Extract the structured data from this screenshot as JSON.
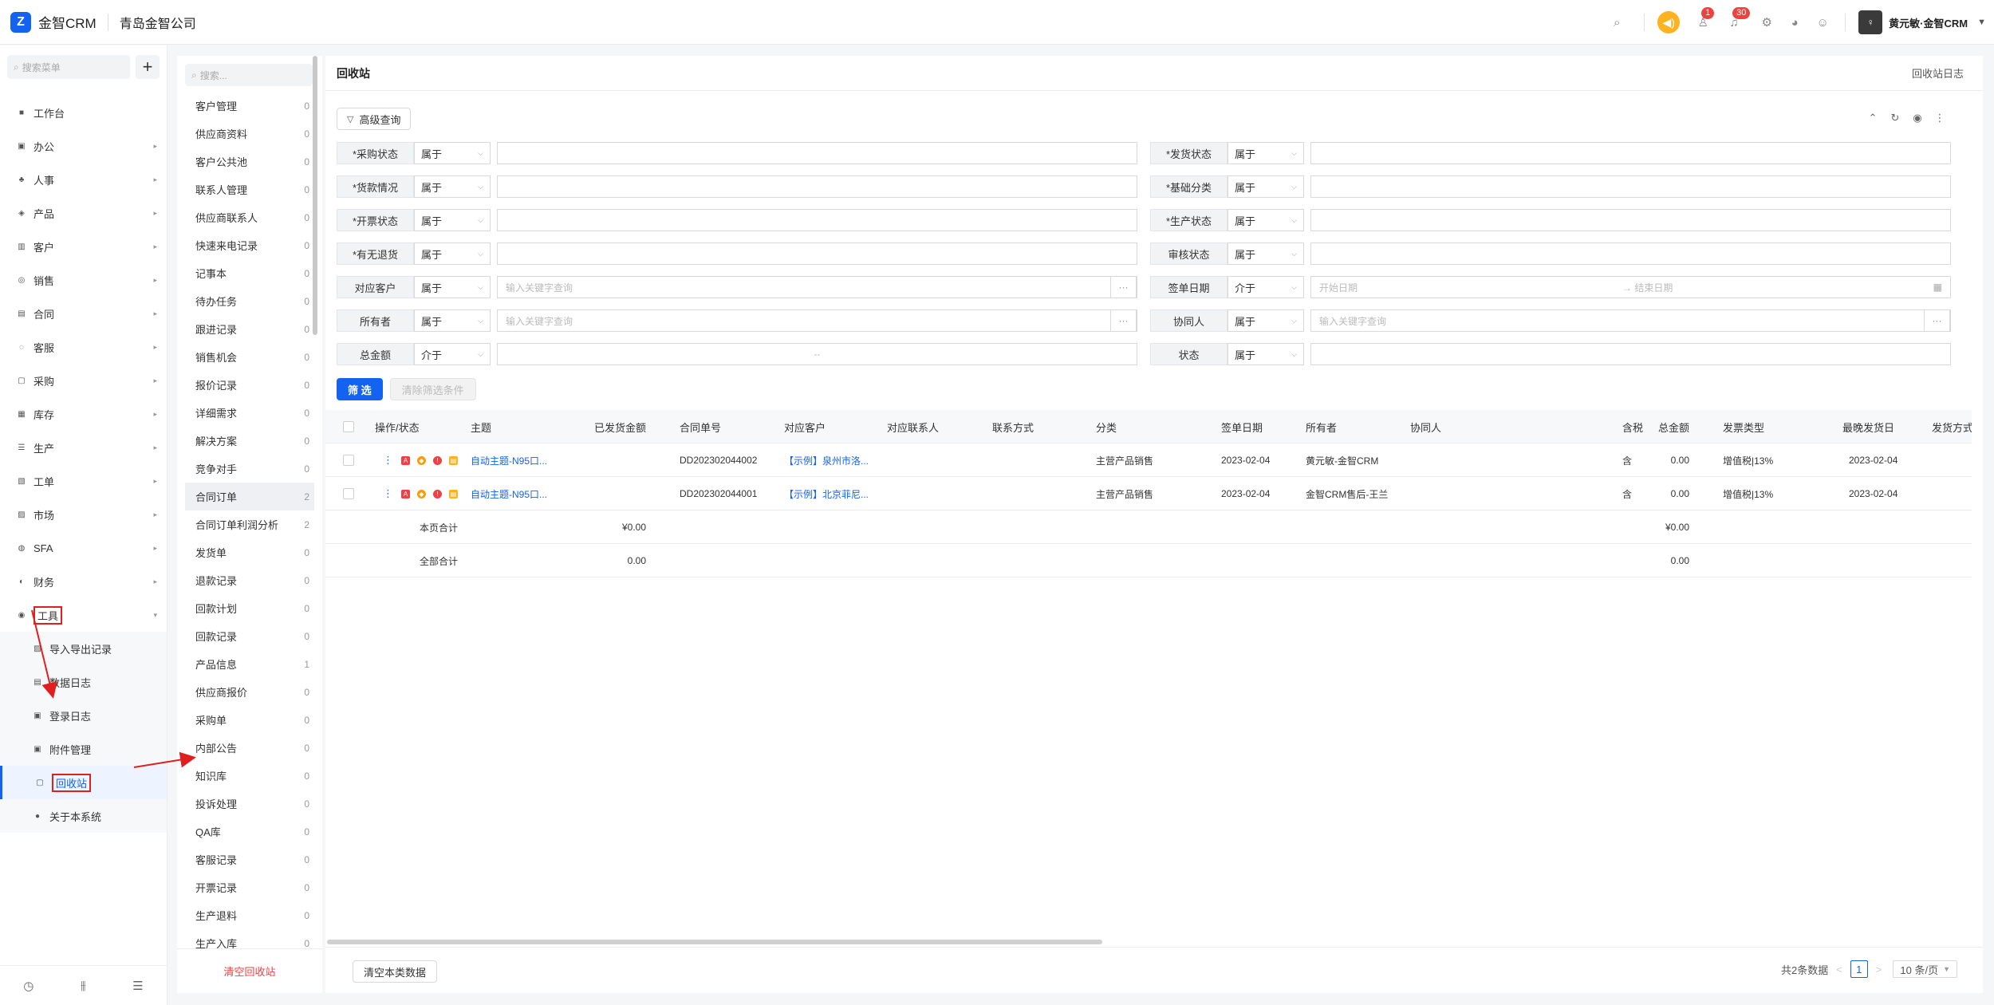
{
  "header": {
    "logo_char": "Z",
    "brand": "金智CRM",
    "company": "青岛金智公司",
    "badge_tasks": "1",
    "badge_notify": "30",
    "username": "黄元敏·金智CRM"
  },
  "nav": {
    "search_placeholder": "搜索菜单",
    "items": [
      {
        "label": "工作台",
        "icon": "■"
      },
      {
        "label": "办公",
        "icon": "▣"
      },
      {
        "label": "人事",
        "icon": "♣"
      },
      {
        "label": "产品",
        "icon": "◈"
      },
      {
        "label": "客户",
        "icon": "▥"
      },
      {
        "label": "销售",
        "icon": "◎"
      },
      {
        "label": "合同",
        "icon": "▤"
      },
      {
        "label": "客服",
        "icon": "◌"
      },
      {
        "label": "采购",
        "icon": "▢"
      },
      {
        "label": "库存",
        "icon": "▦"
      },
      {
        "label": "生产",
        "icon": "☰"
      },
      {
        "label": "工单",
        "icon": "▧"
      },
      {
        "label": "市场",
        "icon": "▨"
      },
      {
        "label": "SFA",
        "icon": "◍"
      },
      {
        "label": "财务",
        "icon": "◐"
      },
      {
        "label": "工具",
        "icon": "◉"
      }
    ],
    "sub_items": [
      {
        "label": "导入导出记录",
        "icon": "▨"
      },
      {
        "label": "数据日志",
        "icon": "▤"
      },
      {
        "label": "登录日志",
        "icon": "▣"
      },
      {
        "label": "附件管理",
        "icon": "▣"
      },
      {
        "label": "回收站",
        "icon": "▢"
      },
      {
        "label": "关于本系统",
        "icon": "●"
      }
    ]
  },
  "categories": {
    "search_placeholder": "搜索...",
    "items": [
      {
        "label": "客户管理",
        "count": "0"
      },
      {
        "label": "供应商资料",
        "count": "0"
      },
      {
        "label": "客户公共池",
        "count": "0"
      },
      {
        "label": "联系人管理",
        "count": "0"
      },
      {
        "label": "供应商联系人",
        "count": "0"
      },
      {
        "label": "快速来电记录",
        "count": "0"
      },
      {
        "label": "记事本",
        "count": "0"
      },
      {
        "label": "待办任务",
        "count": "0"
      },
      {
        "label": "跟进记录",
        "count": "0"
      },
      {
        "label": "销售机会",
        "count": "0"
      },
      {
        "label": "报价记录",
        "count": "0"
      },
      {
        "label": "详细需求",
        "count": "0"
      },
      {
        "label": "解决方案",
        "count": "0"
      },
      {
        "label": "竞争对手",
        "count": "0"
      },
      {
        "label": "合同订单",
        "count": "2"
      },
      {
        "label": "合同订单利润分析",
        "count": "2"
      },
      {
        "label": "发货单",
        "count": "0"
      },
      {
        "label": "退款记录",
        "count": "0"
      },
      {
        "label": "回款计划",
        "count": "0"
      },
      {
        "label": "回款记录",
        "count": "0"
      },
      {
        "label": "产品信息",
        "count": "1"
      },
      {
        "label": "供应商报价",
        "count": "0"
      },
      {
        "label": "采购单",
        "count": "0"
      },
      {
        "label": "内部公告",
        "count": "0"
      },
      {
        "label": "知识库",
        "count": "0"
      },
      {
        "label": "投诉处理",
        "count": "0"
      },
      {
        "label": "QA库",
        "count": "0"
      },
      {
        "label": "客服记录",
        "count": "0"
      },
      {
        "label": "开票记录",
        "count": "0"
      },
      {
        "label": "生产退料",
        "count": "0"
      },
      {
        "label": "生产入库",
        "count": "0"
      }
    ],
    "empty_button": "清空回收站"
  },
  "main": {
    "title": "回收站",
    "log_link": "回收站日志",
    "advanced_query": "高级查询",
    "filters_left": [
      {
        "label": "*采购状态",
        "op": "属于",
        "placeholder": ""
      },
      {
        "label": "*货款情况",
        "op": "属于",
        "placeholder": ""
      },
      {
        "label": "*开票状态",
        "op": "属于",
        "placeholder": ""
      },
      {
        "label": "*有无退货",
        "op": "属于",
        "placeholder": ""
      },
      {
        "label": "对应客户",
        "op": "属于",
        "placeholder": "输入关键字查询"
      },
      {
        "label": "所有者",
        "op": "属于",
        "placeholder": "输入关键字查询"
      },
      {
        "label": "总金额",
        "op": "介于",
        "placeholder": "--"
      }
    ],
    "filters_right": [
      {
        "label": "*发货状态",
        "op": "属于",
        "placeholder": ""
      },
      {
        "label": "*基础分类",
        "op": "属于",
        "placeholder": ""
      },
      {
        "label": "*生产状态",
        "op": "属于",
        "placeholder": ""
      },
      {
        "label": "审核状态",
        "op": "属于",
        "placeholder": ""
      },
      {
        "label": "签单日期",
        "op": "介于",
        "placeholder": "开始日期",
        "placeholder2": "→  结束日期"
      },
      {
        "label": "协同人",
        "op": "属于",
        "placeholder": "输入关键字查询"
      },
      {
        "label": "状态",
        "op": "属于",
        "placeholder": ""
      }
    ],
    "filter_button": "筛 选",
    "clear_filter_button": "清除筛选条件",
    "columns": [
      "操作/状态",
      "主题",
      "已发货金额",
      "合同单号",
      "对应客户",
      "对应联系人",
      "联系方式",
      "分类",
      "签单日期",
      "所有者",
      "协同人",
      "总金额",
      "含税",
      "发票类型",
      "最晚发货日",
      "发货方式"
    ],
    "rows": [
      {
        "subject": "自动主题-N95口...",
        "shipped": "",
        "number": "DD202302044002",
        "customer": "【示例】泉州市洛...",
        "contact": "",
        "phone": "",
        "category": "主营产品销售",
        "date": "2023-02-04",
        "owner": "黄元敏-金智CRM",
        "collab": "",
        "total": "0.00",
        "tax": "含",
        "invoice": "增值税|13%",
        "latest": "2023-02-04",
        "method": ""
      },
      {
        "subject": "自动主题-N95口...",
        "shipped": "",
        "number": "DD202302044001",
        "customer": "【示例】北京菲尼...",
        "contact": "",
        "phone": "",
        "category": "主营产品销售",
        "date": "2023-02-04",
        "owner": "金智CRM售后-王兰",
        "collab": "",
        "total": "0.00",
        "tax": "含",
        "invoice": "增值税|13%",
        "latest": "2023-02-04",
        "method": ""
      }
    ],
    "page_sum_label": "本页合计",
    "page_sum_shipped": "¥0.00",
    "page_sum_total": "¥0.00",
    "all_sum_label": "全部合计",
    "all_sum_shipped": "0.00",
    "all_sum_total": "0.00",
    "clear_type_button": "清空本类数据",
    "total_text": "共2条数据",
    "current_page": "1",
    "page_size": "10 条/页"
  }
}
